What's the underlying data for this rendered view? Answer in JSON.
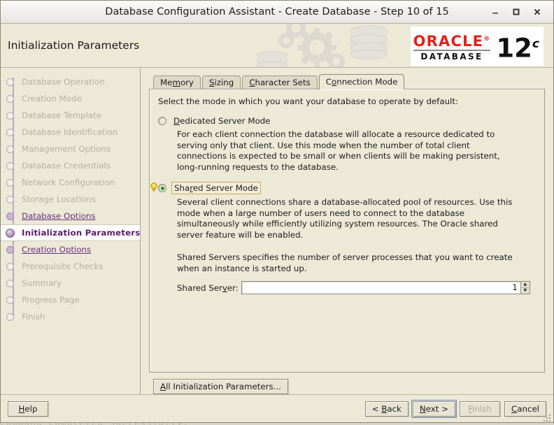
{
  "window": {
    "title": "Database Configuration Assistant - Create Database - Step 10 of 15",
    "minimize_label": "Minimize",
    "maximize_label": "Maximize",
    "close_label": "Close"
  },
  "header": {
    "page_title": "Initialization Parameters",
    "logo": {
      "brand": "ORACLE",
      "product": "DATABASE",
      "version_number": "12",
      "version_suffix": "c"
    }
  },
  "sidebar": {
    "items": [
      {
        "label": "Database Operation",
        "state": "pending"
      },
      {
        "label": "Creation Mode",
        "state": "pending"
      },
      {
        "label": "Database Template",
        "state": "pending"
      },
      {
        "label": "Database Identification",
        "state": "pending"
      },
      {
        "label": "Management Options",
        "state": "pending"
      },
      {
        "label": "Database Credentials",
        "state": "pending"
      },
      {
        "label": "Network Configuration",
        "state": "pending"
      },
      {
        "label": "Storage Locations",
        "state": "pending"
      },
      {
        "label": "Database Options",
        "state": "done"
      },
      {
        "label": "Initialization Parameters",
        "state": "current"
      },
      {
        "label": "Creation Options",
        "state": "done"
      },
      {
        "label": "Prerequisite Checks",
        "state": "pending"
      },
      {
        "label": "Summary",
        "state": "pending"
      },
      {
        "label": "Progress Page",
        "state": "pending"
      },
      {
        "label": "Finish",
        "state": "pending"
      }
    ]
  },
  "tabs": [
    {
      "label": "Memory",
      "mnemonic": "m",
      "active": false
    },
    {
      "label": "Sizing",
      "mnemonic": "S",
      "active": false
    },
    {
      "label": "Character Sets",
      "mnemonic": "C",
      "active": false
    },
    {
      "label": "Connection Mode",
      "mnemonic": "o",
      "active": true
    }
  ],
  "panel": {
    "intro": "Select the mode in which you want your database to operate by default:",
    "options": [
      {
        "label": "Dedicated Server Mode",
        "mnemonic": "D",
        "selected": false,
        "focused": false,
        "hint_icon": false,
        "description": "For each client connection the database will allocate a resource dedicated to serving only that client.  Use this mode when the number of total client connections is expected to be small or when clients will be making persistent, long-running requests to the database."
      },
      {
        "label": "Shared Server Mode",
        "mnemonic": "r",
        "selected": true,
        "focused": true,
        "hint_icon": true,
        "description": "Several client connections share a database-allocated pool of resources.  Use this mode when a large number of users need to connect to the database simultaneously while efficiently utilizing system resources.  The Oracle shared server feature will be enabled."
      }
    ],
    "shared_servers_note": "Shared Servers specifies the number of server processes that you want to create when an instance is started up.",
    "shared_server_field": {
      "label": "Shared Server:",
      "mnemonic": "v",
      "value": "1"
    }
  },
  "all_params_button": {
    "label": "All Initialization Parameters...",
    "mnemonic": "A"
  },
  "footer": {
    "help": {
      "label": "Help",
      "mnemonic": "H",
      "enabled": true,
      "focused": false
    },
    "back": {
      "label": "< Back",
      "mnemonic": "B",
      "enabled": true,
      "focused": false
    },
    "next": {
      "label": "Next >",
      "mnemonic": "N",
      "enabled": true,
      "focused": true
    },
    "finish": {
      "label": "Finish",
      "mnemonic": "F",
      "enabled": false,
      "focused": false
    },
    "cancel": {
      "label": "Cancel",
      "mnemonic": "C",
      "enabled": true,
      "focused": false
    }
  },
  "background": {
    "terminal_text": "Command completed successfully."
  },
  "colors": {
    "window_bg": "#ece9d7",
    "oracle_red": "#e32119",
    "current_step": "#5c1b6e",
    "visited_step": "#6b2e7e",
    "pending_step": "#b5b0a0",
    "radio_selected": "#1f8a1f",
    "focus_ring": "#d4a74b"
  }
}
